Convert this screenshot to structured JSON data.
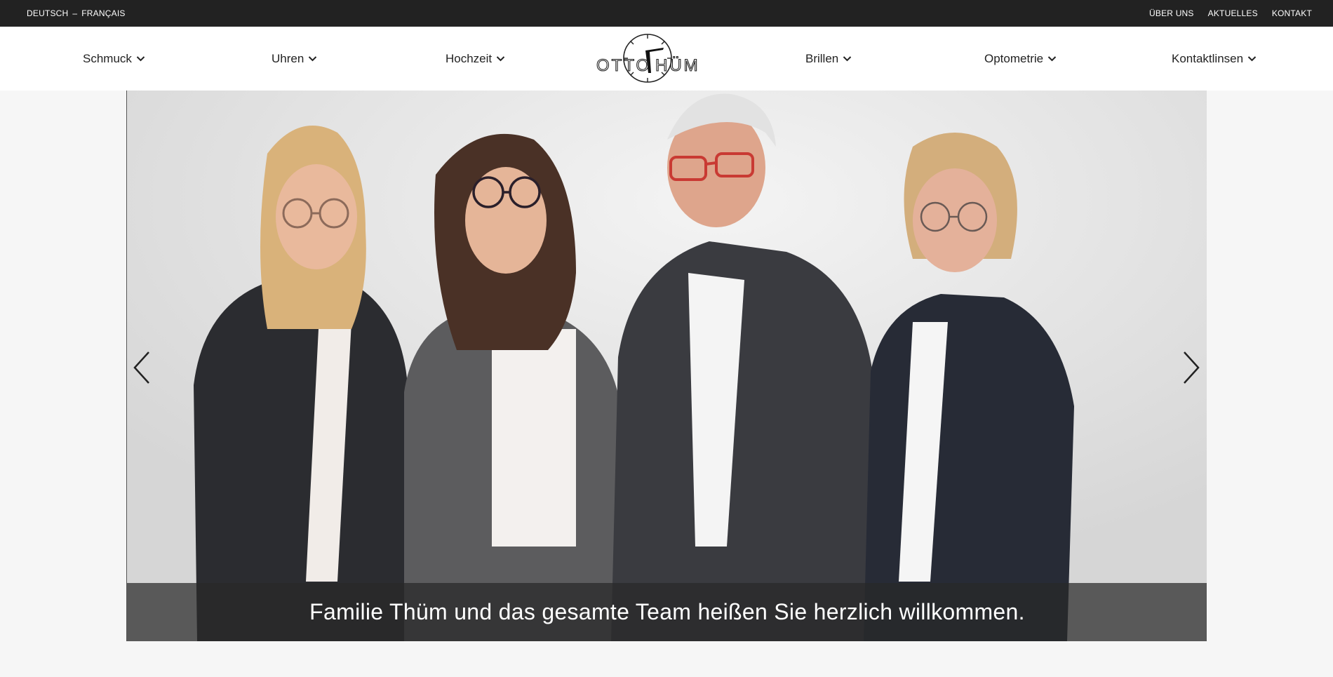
{
  "topbar": {
    "lang_de": "DEUTSCH",
    "lang_sep": "–",
    "lang_fr": "FRANÇAIS",
    "links": [
      "ÜBER UNS",
      "AKTUELLES",
      "KONTAKT"
    ]
  },
  "nav": {
    "items": [
      "Schmuck",
      "Uhren",
      "Hochzeit",
      "Brillen",
      "Optometrie",
      "Kontaktlinsen"
    ],
    "logo_text": "OTTO THÜM"
  },
  "slider": {
    "caption": "Familie Thüm und das gesamte Team heißen Sie herzlich willkommen.",
    "prev_icon": "chevron-left-icon",
    "next_icon": "chevron-right-icon"
  },
  "colors": {
    "topbar_bg": "#222222",
    "nav_bg": "#ffffff",
    "page_bg": "#f6f6f6",
    "caption_bg": "rgba(40,40,40,0.72)"
  }
}
